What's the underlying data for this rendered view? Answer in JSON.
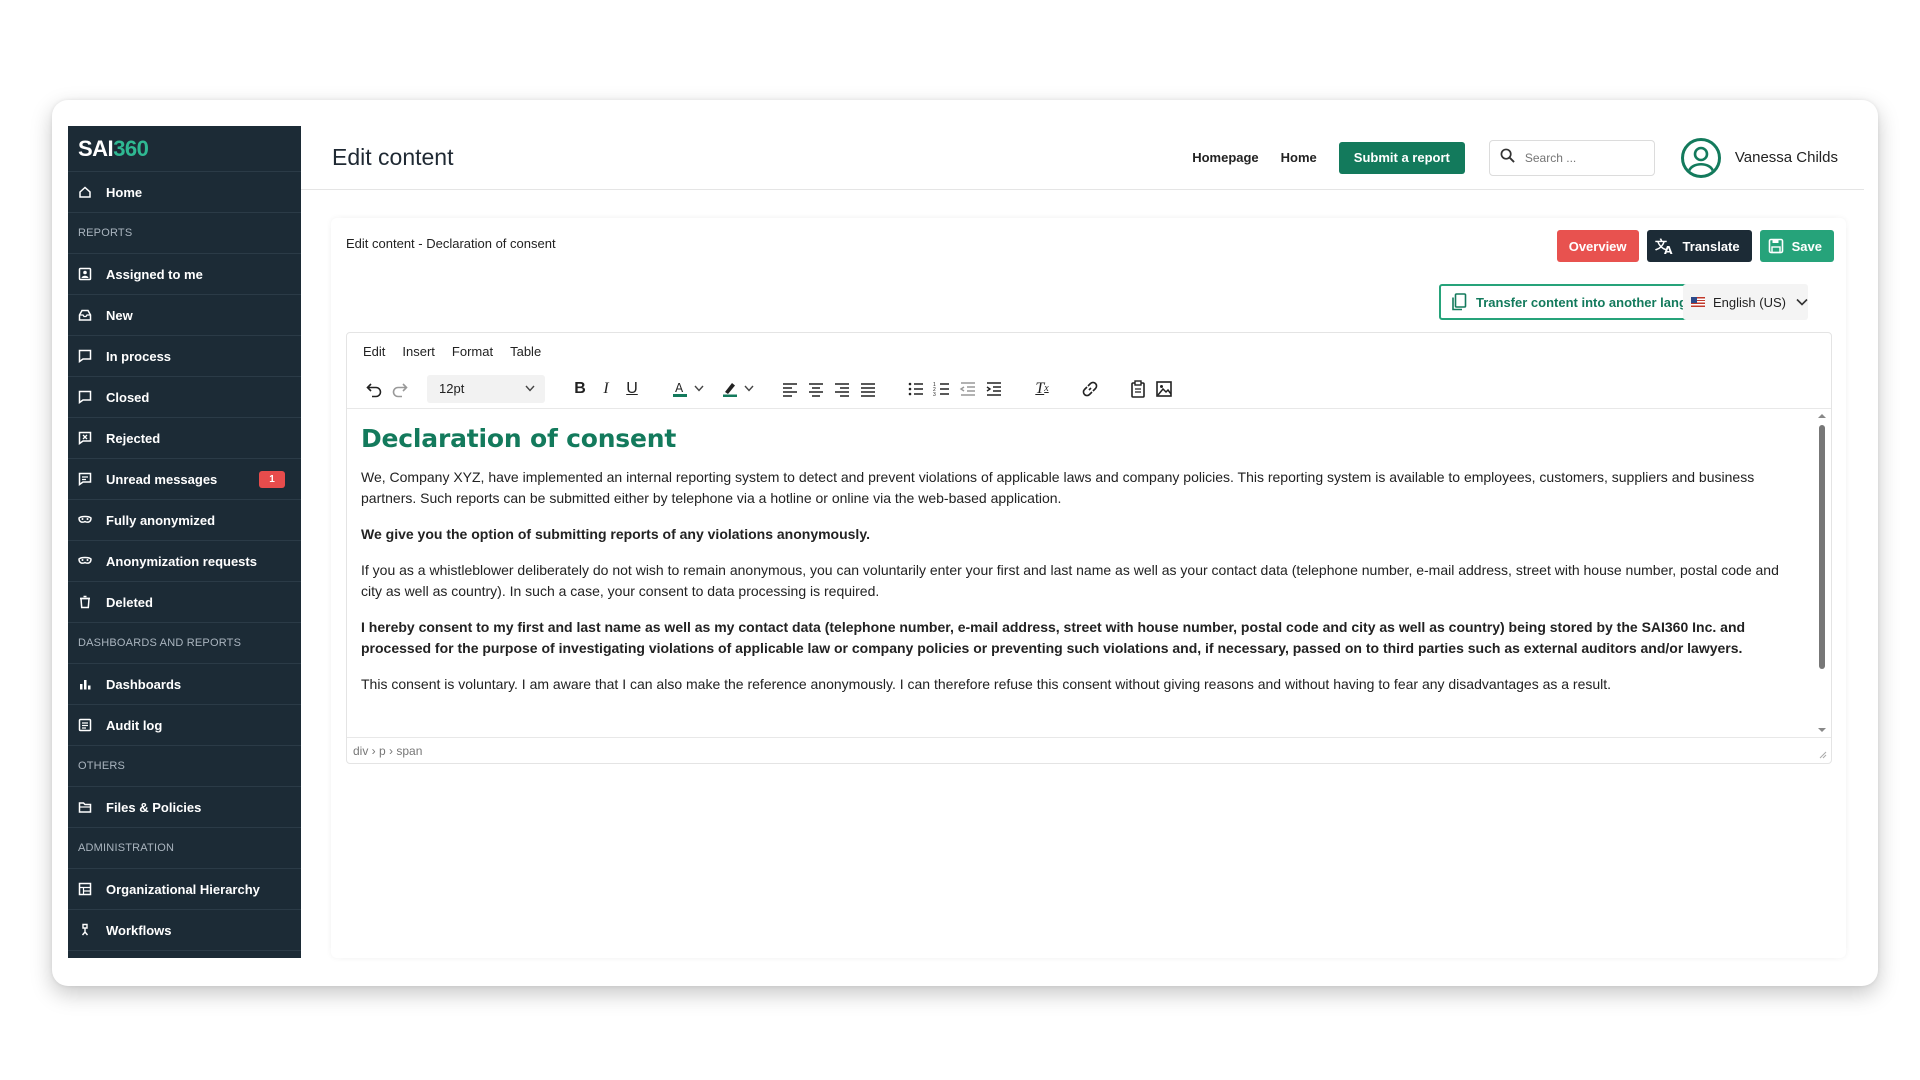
{
  "app": {
    "logo_main": "SAI",
    "logo_accent": "360"
  },
  "sidebar": {
    "items": [
      {
        "type": "item",
        "label": "Home",
        "icon": "home-icon"
      },
      {
        "type": "section",
        "label": "REPORTS"
      },
      {
        "type": "item",
        "label": "Assigned to me",
        "icon": "assigned-icon"
      },
      {
        "type": "item",
        "label": "New",
        "icon": "inbox-icon"
      },
      {
        "type": "item",
        "label": "In process",
        "icon": "report-icon"
      },
      {
        "type": "item",
        "label": "Closed",
        "icon": "report-icon"
      },
      {
        "type": "item",
        "label": "Rejected",
        "icon": "rejected-icon"
      },
      {
        "type": "item",
        "label": "Unread messages",
        "icon": "message-icon",
        "badge": "1"
      },
      {
        "type": "item",
        "label": "Fully anonymized",
        "icon": "mask-icon"
      },
      {
        "type": "item",
        "label": "Anonymization requests",
        "icon": "mask-icon"
      },
      {
        "type": "item",
        "label": "Deleted",
        "icon": "trash-icon"
      },
      {
        "type": "section",
        "label": "DASHBOARDS AND REPORTS"
      },
      {
        "type": "item",
        "label": "Dashboards",
        "icon": "bar-chart-icon"
      },
      {
        "type": "item",
        "label": "Audit log",
        "icon": "log-icon"
      },
      {
        "type": "section",
        "label": "OTHERS"
      },
      {
        "type": "item",
        "label": "Files & Policies",
        "icon": "folder-icon"
      },
      {
        "type": "section",
        "label": "ADMINISTRATION"
      },
      {
        "type": "item",
        "label": "Organizational Hierarchy",
        "icon": "hierarchy-icon"
      },
      {
        "type": "item",
        "label": "Workflows",
        "icon": "workflow-icon"
      }
    ]
  },
  "header": {
    "title": "Edit content",
    "nav": [
      "Homepage",
      "Home"
    ],
    "submit_label": "Submit a report",
    "search_placeholder": "Search ...",
    "user_name": "Vanessa Childs"
  },
  "card": {
    "breadcrumb": "Edit content - Declaration of consent",
    "overview_label": "Overview",
    "translate_label": "Translate",
    "save_label": "Save",
    "transfer_label": "Transfer content into another language",
    "language": "English (US)"
  },
  "editor": {
    "menu": [
      "Edit",
      "Insert",
      "Format",
      "Table"
    ],
    "font_size": "12pt",
    "heading": "Declaration of consent",
    "paragraphs": [
      {
        "bold": false,
        "text": "We, Company XYZ, have implemented an internal reporting system to detect and prevent violations of applicable laws and company policies. This reporting system is available to employees, customers, suppliers and business partners. Such reports can be submitted either by telephone via a hotline or online via the web-based application."
      },
      {
        "bold": true,
        "text": "We give you the option of submitting reports of any violations anonymously."
      },
      {
        "bold": false,
        "text": "If you as a whistleblower deliberately do not wish to remain anonymous, you can voluntarily enter your first and last name as well as your contact data (telephone number, e-mail address, street with house number, postal code and city as well as country). In such a case, your consent to data processing is required."
      },
      {
        "bold": true,
        "text": "I hereby consent to my first and last name as well as my contact data (telephone number, e-mail address, street with house number, postal code and city as well as country) being stored by the SAI360 Inc. and processed for the purpose of investigating violations of applicable law or company policies or preventing such violations and, if necessary, passed on to third parties such as external auditors and/or lawyers."
      },
      {
        "bold": false,
        "text": "This consent is voluntary. I am aware that I can also make the reference anonymously. I can therefore refuse this consent without giving reasons and without having to fear any disadvantages as a result."
      }
    ],
    "status_path": "div › p › span"
  },
  "colors": {
    "sidebar_bg": "#1c2b36",
    "brand_green": "#137a5c",
    "save_green": "#26a37a",
    "overview_red": "#e8524f",
    "badge_red": "#e74c4c"
  }
}
